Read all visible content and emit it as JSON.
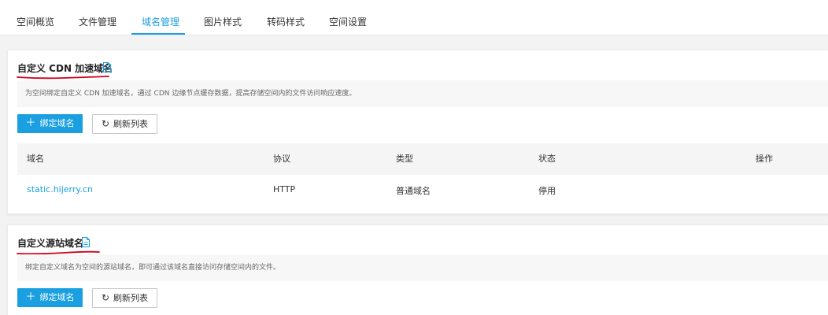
{
  "tabs": [
    {
      "label": "空间概览"
    },
    {
      "label": "文件管理"
    },
    {
      "label": "域名管理"
    },
    {
      "label": "图片样式"
    },
    {
      "label": "转码样式"
    },
    {
      "label": "空间设置"
    }
  ],
  "active_tab": "域名管理",
  "cdn_section": {
    "title": "自定义 CDN 加速域名",
    "description": "为空间绑定自定义 CDN 加速域名，通过 CDN 边缘节点缓存数据，提高存储空间内的文件访问响应速度。",
    "bind_button": "绑定域名",
    "refresh_button": "刷新列表",
    "columns": [
      "域名",
      "协议",
      "类型",
      "状态",
      "操作"
    ],
    "rows": [
      {
        "domain": "static.hijerry.cn",
        "protocol": "HTTP",
        "type": "普通域名",
        "status": "停用",
        "action": ""
      }
    ]
  },
  "origin_section": {
    "title": "自定义源站域名",
    "description": "绑定自定义域名为空间的源站域名，即可通过该域名直接访问存储空间内的文件。",
    "bind_button": "绑定域名",
    "refresh_button": "刷新列表"
  },
  "colors": {
    "accent": "#1a9fe0",
    "annotation": "#d0021b"
  },
  "icons": {
    "doc": "doc-icon",
    "plus": "plus-icon",
    "refresh": "refresh-icon"
  }
}
